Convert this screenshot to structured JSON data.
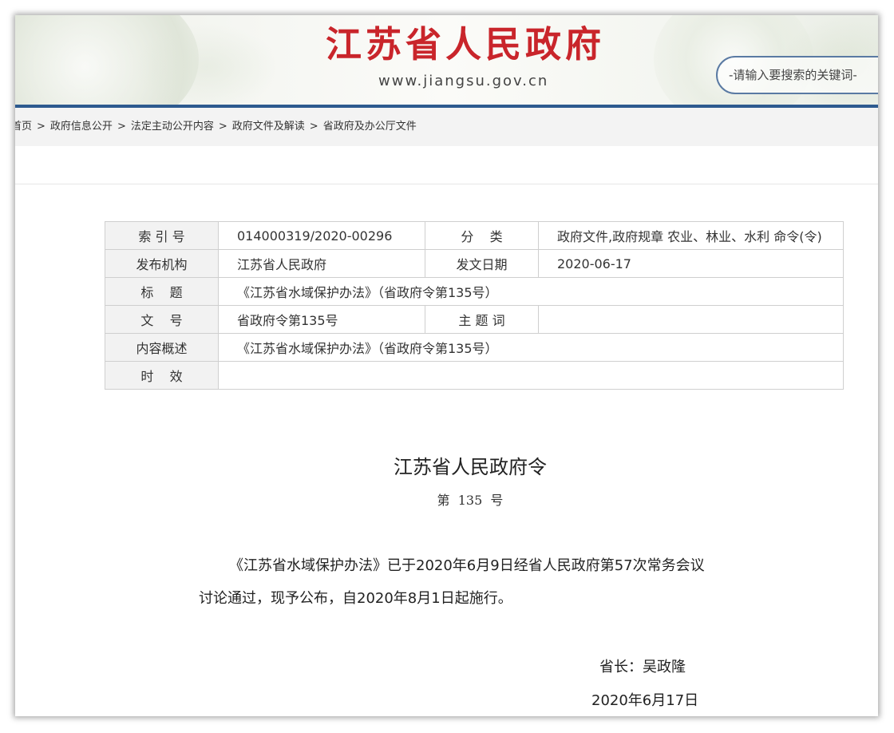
{
  "header": {
    "site_title": "江苏省人民政府",
    "site_domain": "www.jiangsu.gov.cn",
    "search_placeholder": "-请输入要搜索的关键词-"
  },
  "breadcrumb": [
    "首页",
    "政府信息公开",
    "法定主动公开内容",
    "政府文件及解读",
    "省政府及办公厅文件"
  ],
  "meta_table": {
    "index_label": "索 引 号",
    "index_value": "014000319/2020-00296",
    "category_label": "分    类",
    "category_value": "政府文件,政府规章 农业、林业、水利 命令(令)",
    "publisher_label": "发布机构",
    "publisher_value": "江苏省人民政府",
    "date_label": "发文日期",
    "date_value": "2020-06-17",
    "title_label": "标    题",
    "title_value": "《江苏省水域保护办法》（省政府令第135号）",
    "doc_no_label": "文    号",
    "doc_no_value": "省政府令第135号",
    "keywords_label": "主 题 词",
    "keywords_value": "",
    "summary_label": "内容概述",
    "summary_value": "《江苏省水域保护办法》（省政府令第135号）",
    "validity_label": "时    效",
    "validity_value": ""
  },
  "article": {
    "title": "江苏省人民政府令",
    "number": "第  135  号",
    "paragraph_1": "《江苏省水域保护办法》已于2020年6月9日经省人民政府第57次常务会议",
    "paragraph_2": "讨论通过，现予公布，自2020年8月1日起施行。",
    "signer": "省长：吴政隆",
    "sign_date": "2020年6月17日"
  },
  "colors": {
    "title_red": "#c9252b",
    "nav_blue": "#2d5a8f"
  }
}
